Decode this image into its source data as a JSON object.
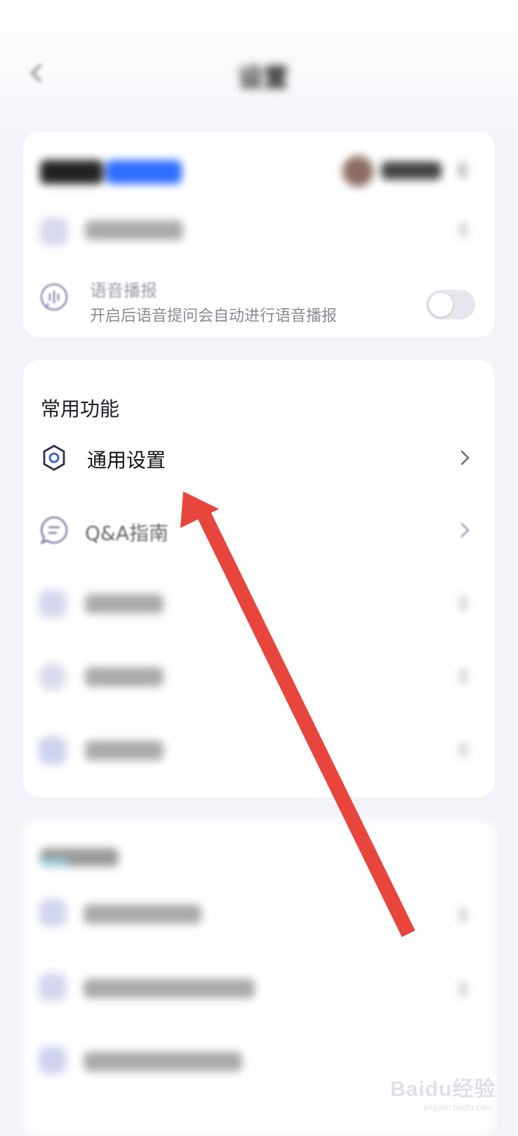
{
  "voice_broadcast": {
    "title": "语音播报",
    "description": "开启后语音提问会自动进行语音播报",
    "enabled": false
  },
  "common_functions": {
    "title": "常用功能",
    "items": [
      {
        "label": "通用设置",
        "icon": "gear-icon"
      },
      {
        "label": "Q&A指南",
        "icon": "chat-bubble-icon"
      }
    ]
  },
  "annotation": {
    "color": "#e8453c"
  },
  "watermark": {
    "text": "Baidu经验",
    "sub": "jingyan.baidu.com"
  }
}
